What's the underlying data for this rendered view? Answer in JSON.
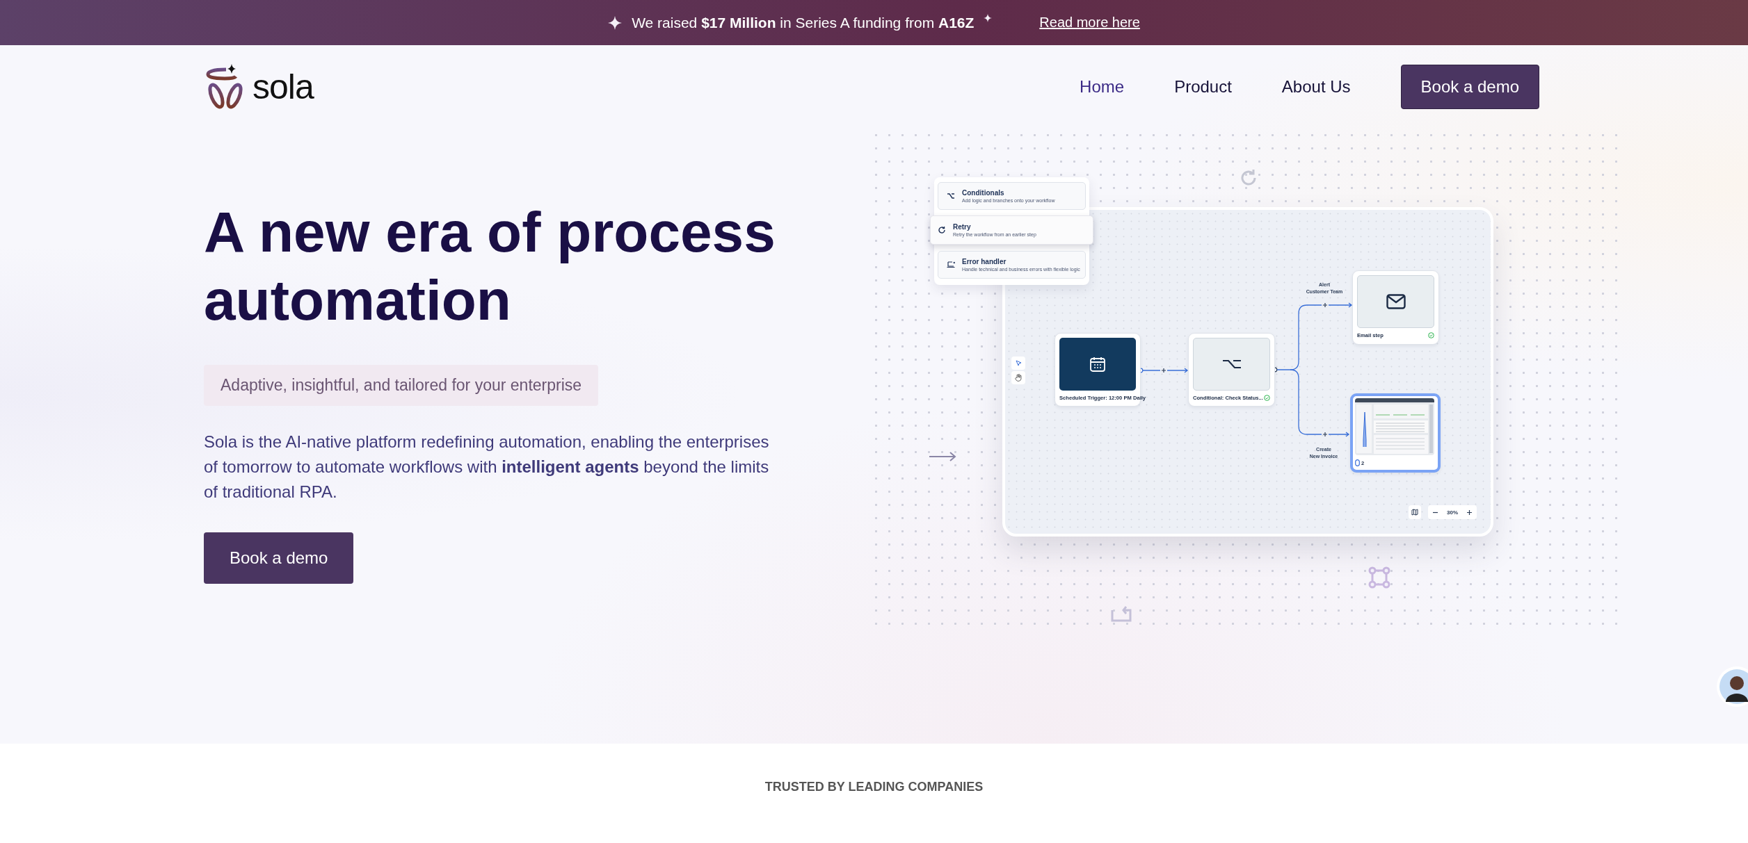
{
  "banner": {
    "text": "We raised **$17 Million** in Series A funding from **A16Z**",
    "link": "Read more here"
  },
  "nav": {
    "logo": "sola",
    "items": [
      {
        "label": "Home",
        "selected": true
      },
      {
        "label": "Product",
        "selected": false
      },
      {
        "label": "About Us",
        "selected": false
      }
    ],
    "cta": "Book a demo"
  },
  "hero": {
    "title": "A new era of process automation",
    "tagline": "Adaptive, insightful, and tailored for your enterprise",
    "body": "Sola is the AI-native platform redefining automation, enabling the enterprises of tomorrow to automate workflows with **intelligent agents** beyond the limits of traditional RPA.",
    "button": "Book a demo"
  },
  "workflow": {
    "menu": [
      {
        "kind": "branch",
        "title": "Conditionals",
        "description": "Add logic and branches onto your workflow",
        "selected": false
      },
      {
        "kind": "retry",
        "title": "Retry",
        "description": "Retry the workflow from an earlier step",
        "selected": true
      },
      {
        "kind": "error",
        "title": "Error handler",
        "description": "Handle technical and business errors with flexible logic",
        "selected": false
      }
    ],
    "tools": [
      {
        "kind": "pointer",
        "selected": true
      },
      {
        "kind": "hand",
        "selected": false
      }
    ],
    "nodes": [
      {
        "kind": "trigger",
        "title": "Scheduled Trigger: 12:00 PM Daily",
        "checked": false,
        "selected": false
      },
      {
        "kind": "condition",
        "title": "Conditional: Check Status...",
        "checked": true,
        "selected": false
      },
      {
        "kind": "email",
        "title": "Email step",
        "checked": true,
        "selected": false
      },
      {
        "kind": "screen",
        "title": "2",
        "checked": false,
        "selected": true
      }
    ],
    "branches": [
      {
        "label": [
          "Alert",
          "Customer Team"
        ]
      },
      {
        "label": [
          "Create",
          "New Invoice"
        ]
      }
    ],
    "zoom": "30%"
  },
  "trusted": {
    "heading": "TRUSTED BY LEADING COMPANIES"
  }
}
